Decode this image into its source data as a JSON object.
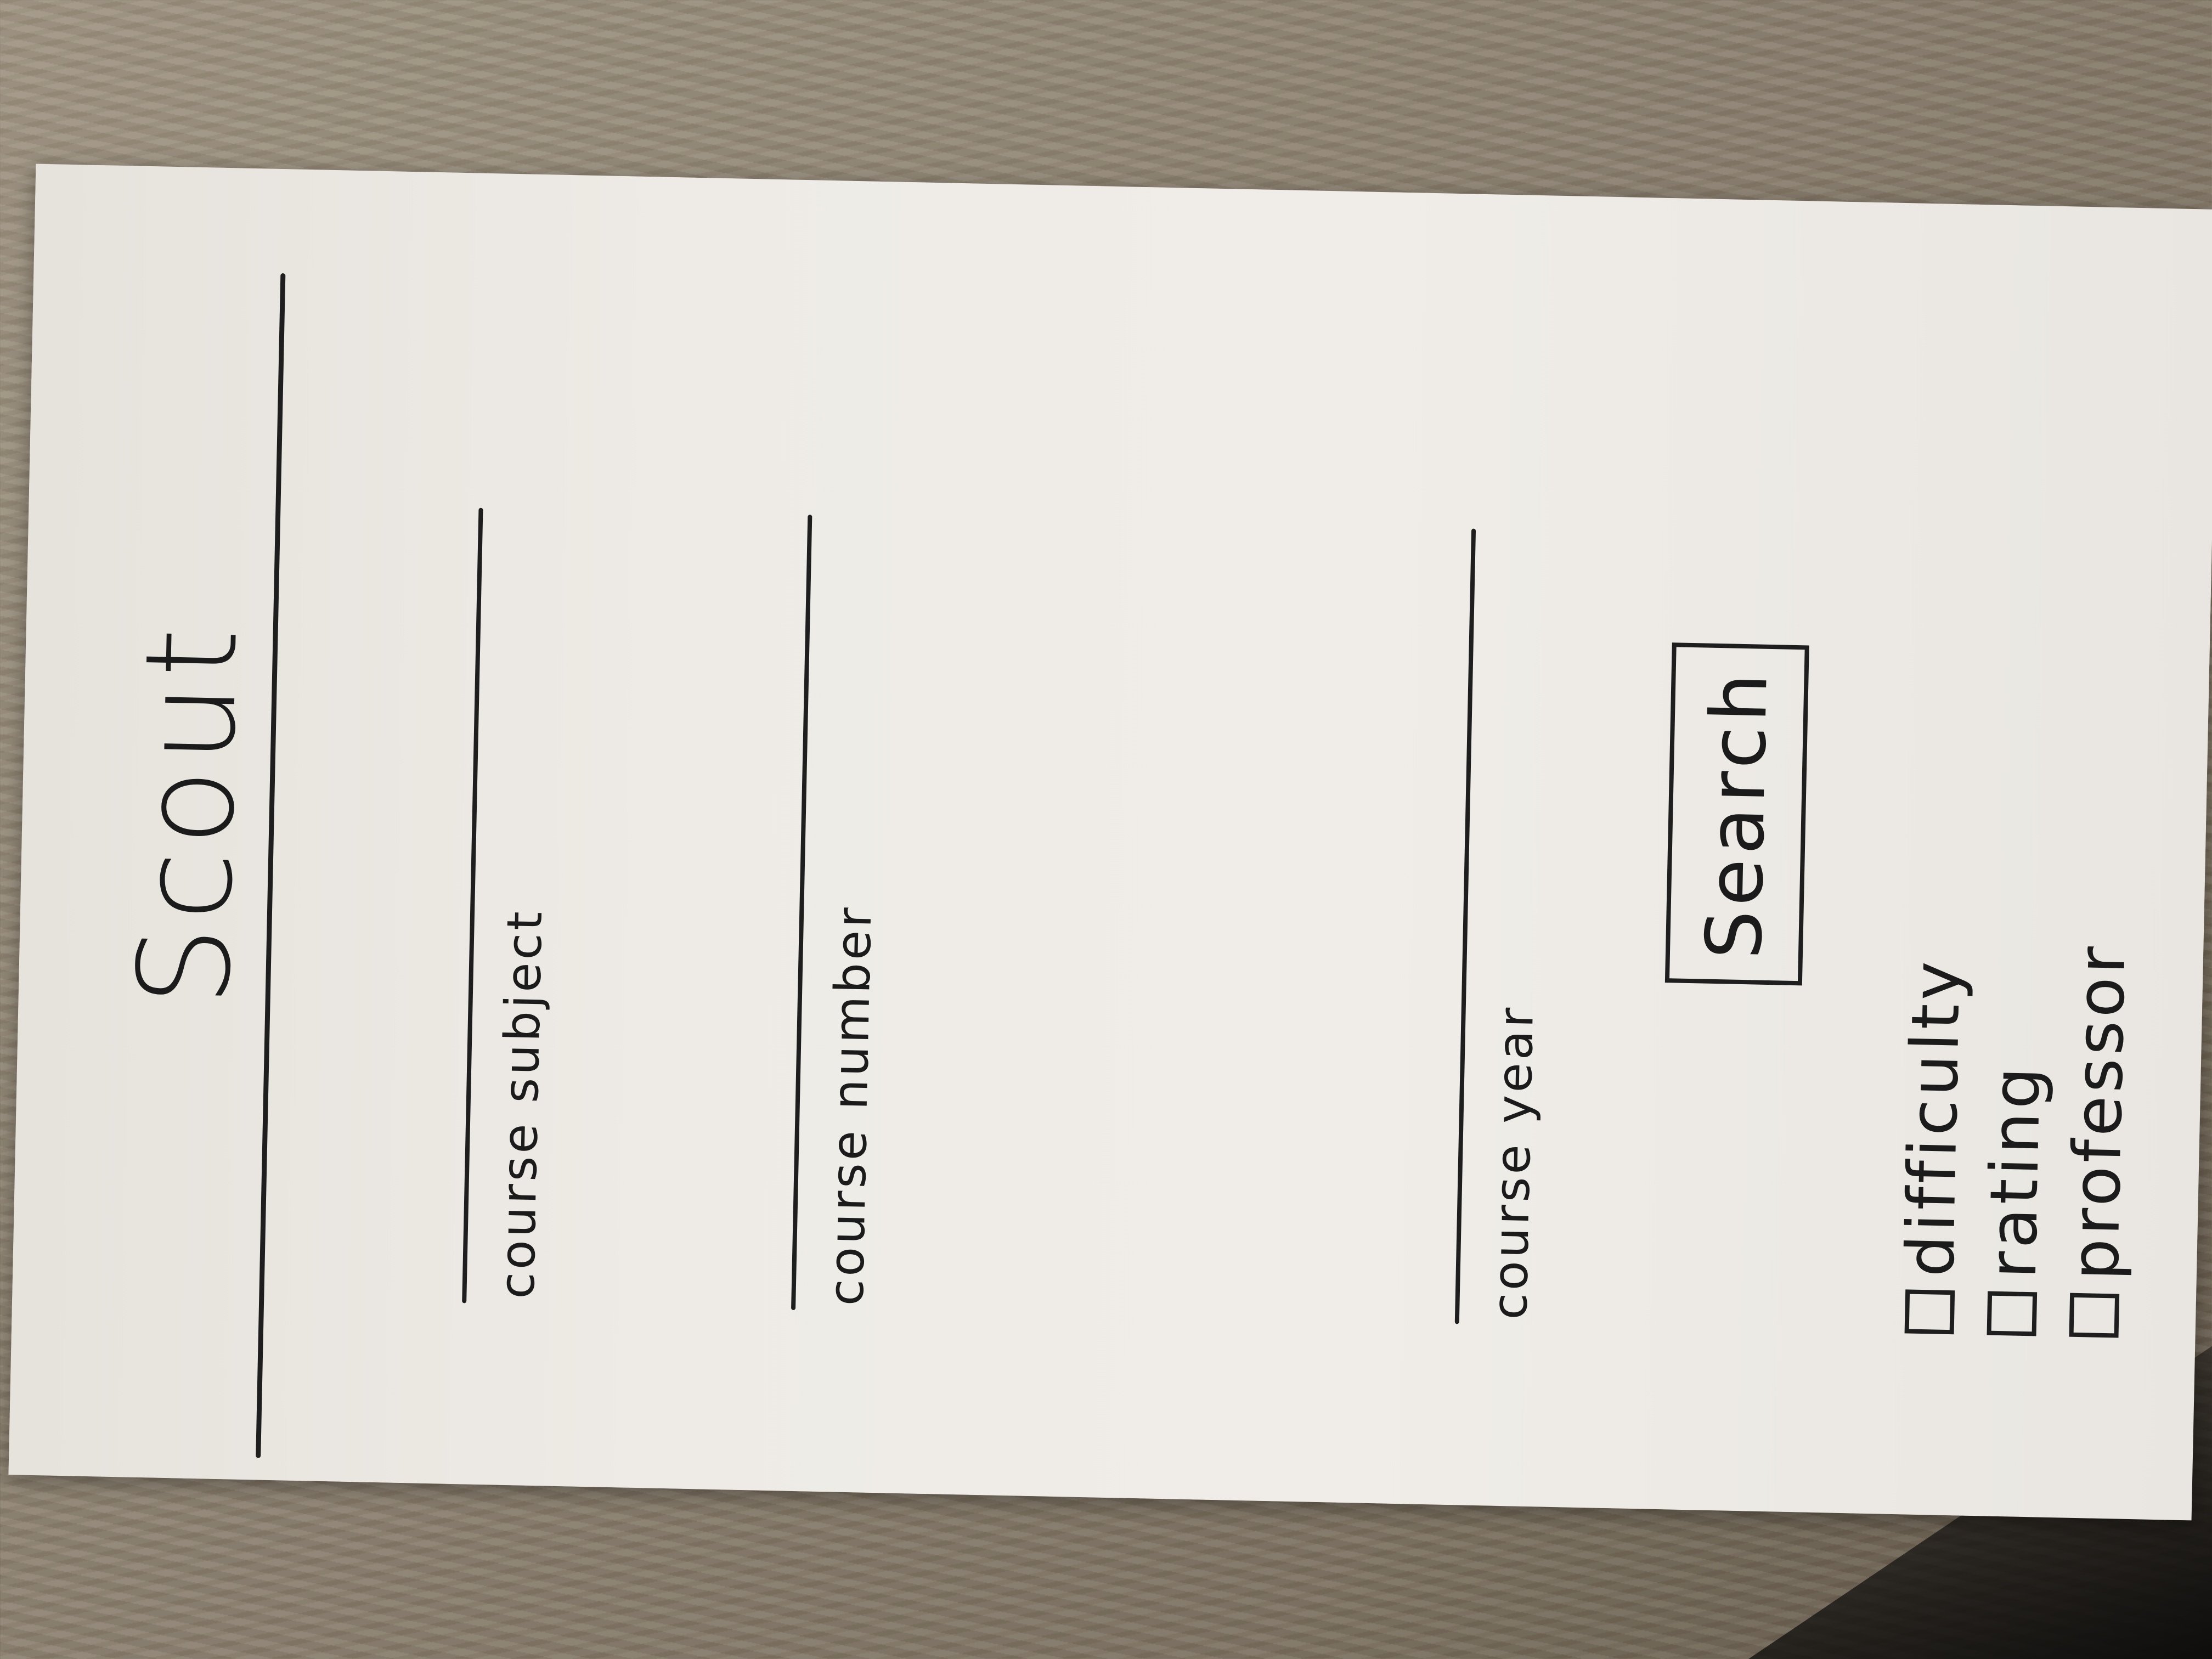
{
  "app": {
    "title": "Scout"
  },
  "form": {
    "fields": [
      {
        "label": "course subject",
        "value": ""
      },
      {
        "label": "course number",
        "value": ""
      },
      {
        "label": "course year",
        "value": ""
      }
    ],
    "search_button_label": "Search"
  },
  "filters": [
    {
      "label": "difficulty",
      "checked": false
    },
    {
      "label": "rating",
      "checked": false
    },
    {
      "label": "professor",
      "checked": false
    }
  ]
}
